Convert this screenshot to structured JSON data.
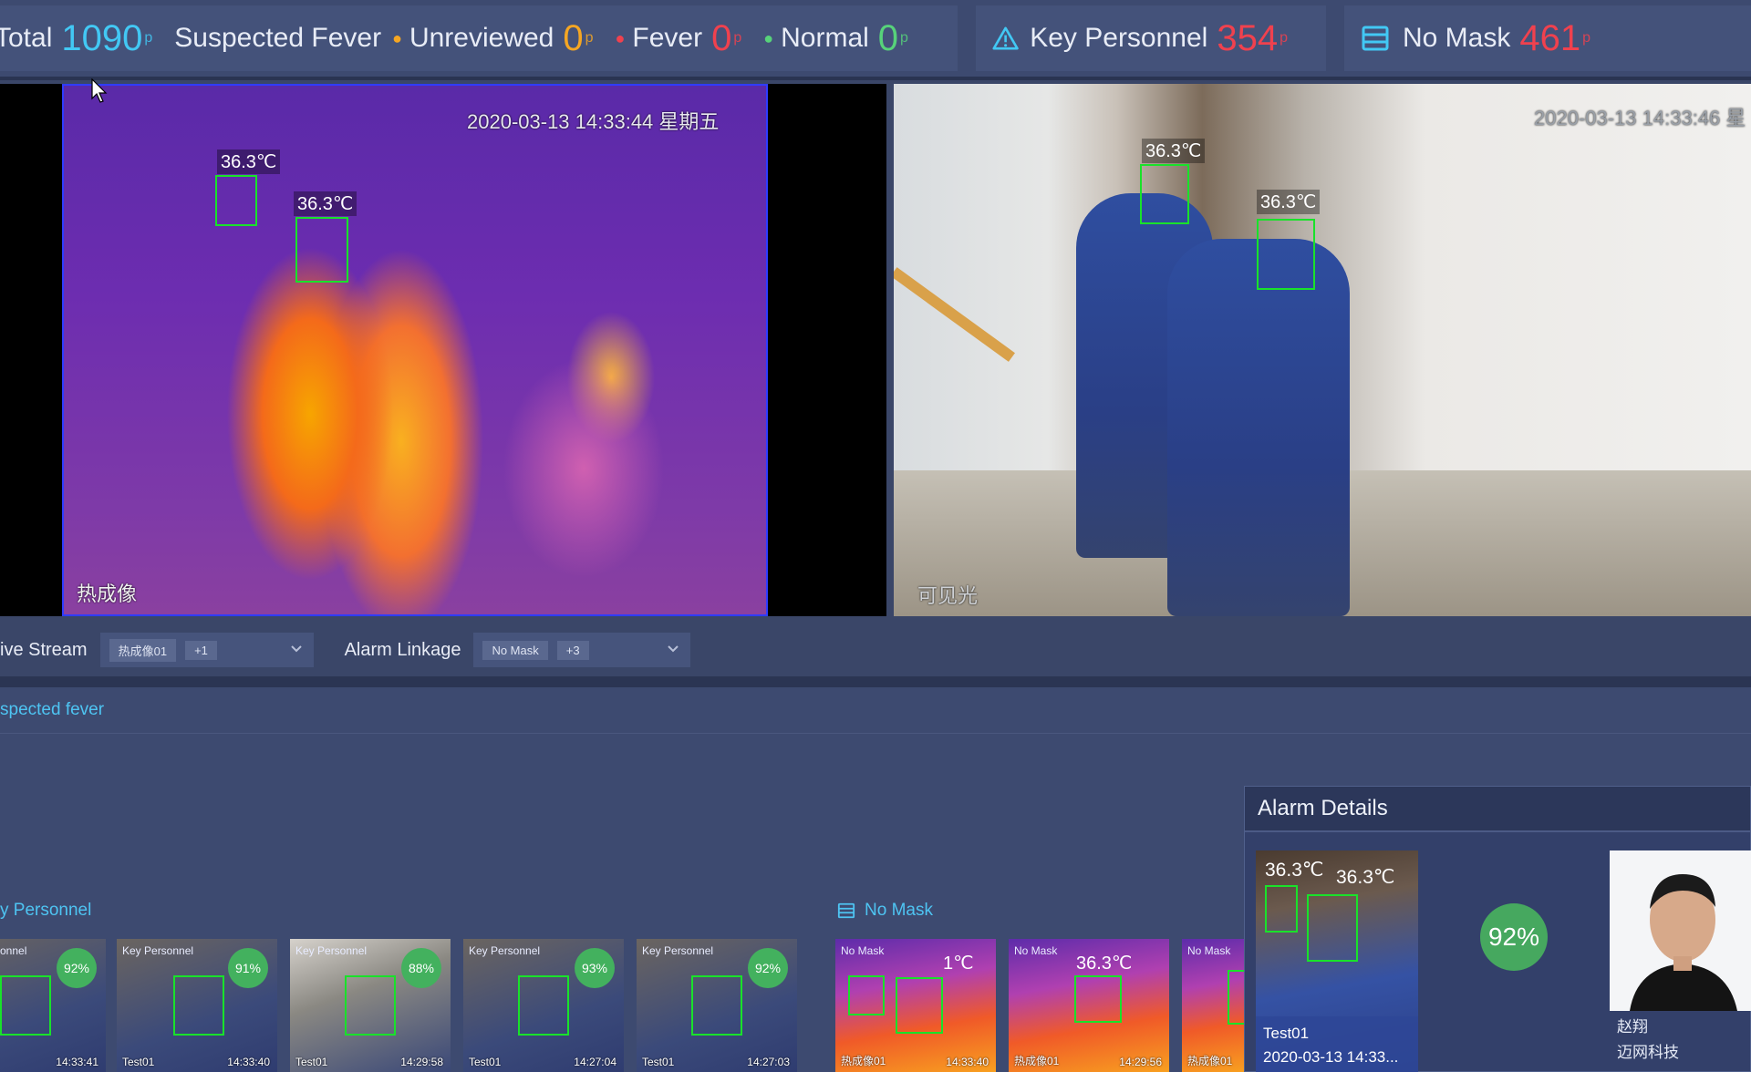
{
  "stats": {
    "total_label": "Total",
    "total_value": "1090",
    "unit": "p",
    "suspected_label": "Suspected Fever",
    "unreviewed_label": "Unreviewed",
    "unreviewed_value": "0",
    "fever_label": "Fever",
    "fever_value": "0",
    "normal_label": "Normal",
    "normal_value": "0",
    "key_label": "Key Personnel",
    "key_value": "354",
    "mask_label": "No Mask",
    "mask_value": "461"
  },
  "video": {
    "thermal_timestamp": "2020-03-13 14:33:44 星期五",
    "thermal_label": "热成像",
    "visible_timestamp": "2020-03-13 14:33:46 星",
    "visible_label": "可见光",
    "temps": [
      "36.3℃",
      "36.3℃",
      "36.3℃",
      "36.3℃"
    ]
  },
  "controls": {
    "live_stream_label": "ive Stream",
    "live_stream_chip": "热成像01",
    "live_stream_count": "+1",
    "alarm_linkage_label": "Alarm Linkage",
    "alarm_linkage_chip": "No Mask",
    "alarm_linkage_count": "+3"
  },
  "sections": {
    "suspected": "spected fever",
    "key_personnel": "y Personnel",
    "no_mask": "No Mask"
  },
  "key_thumbs": [
    {
      "tag": "onnel",
      "score": "92%",
      "name": "",
      "time": "14:33:41"
    },
    {
      "tag": "Key Personnel",
      "score": "91%",
      "name": "Test01",
      "time": "14:33:40"
    },
    {
      "tag": "Key Personnel",
      "score": "88%",
      "name": "Test01",
      "time": "14:29:58"
    },
    {
      "tag": "Key Personnel",
      "score": "93%",
      "name": "Test01",
      "time": "14:27:04"
    },
    {
      "tag": "Key Personnel",
      "score": "92%",
      "name": "Test01",
      "time": "14:27:03"
    }
  ],
  "mask_thumbs": [
    {
      "tag": "No Mask",
      "temp": "1℃",
      "name": "热成像01",
      "time": "14:33:40"
    },
    {
      "tag": "No Mask",
      "temp": "36.3℃",
      "name": "热成像01",
      "time": "14:29:56"
    },
    {
      "tag": "No Mask",
      "temp": "",
      "name": "热成像01",
      "time": ""
    }
  ],
  "alarm": {
    "title": "Alarm Details",
    "snap_temps": [
      "36.3℃",
      "36.3℃"
    ],
    "snap_name": "Test01",
    "snap_time": "2020-03-13 14:33...",
    "score": "92%",
    "person_name": "赵翔",
    "person_org": "迈网科技"
  },
  "colors": {
    "accent": "#42c8f4",
    "warning": "#f5a623",
    "danger": "#f0414e",
    "ok": "#57d27a",
    "match": "#46a85f"
  }
}
